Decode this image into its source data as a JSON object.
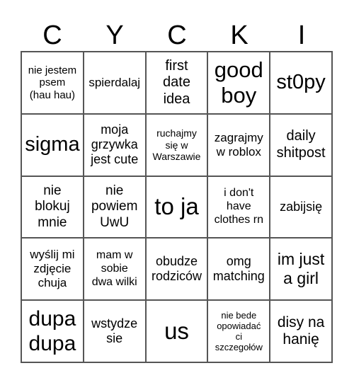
{
  "header": [
    "C",
    "Y",
    "C",
    "K",
    "I"
  ],
  "cells": [
    "nie jestem\npsem\n(hau hau)",
    "spierdalaj",
    "first\ndate\nidea",
    "good\nboy",
    "st0py",
    "sigma",
    "moja\ngrzywka\njest cute",
    "ruchajmy\nsię w\nWarszawie",
    "zagrajmy\nw roblox",
    "daily\nshitpost",
    "nie\nblokuj\nmnie",
    "nie\npowiem\nUwU",
    "to ja",
    "i don't\nhave\nclothes rn",
    "zabijsię",
    "wyślij mi\nzdjęcie\nchuja",
    "mam w\nsobie\ndwa wilki",
    "obudze\nrodziców",
    "omg\nmatching",
    "im just\na girl",
    "dupa\ndupa",
    "wstydze\nsie",
    "us",
    "nie bede\nopowiadać\nci\nszczegołów",
    "disy na\nhanię"
  ]
}
